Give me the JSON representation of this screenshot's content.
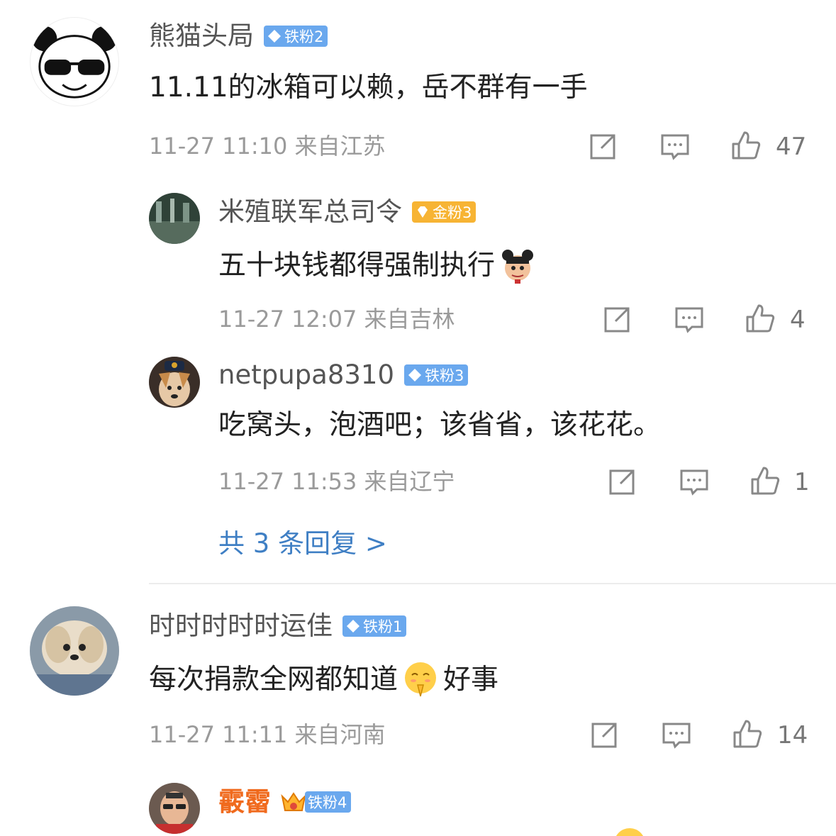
{
  "comments": [
    {
      "user": "熊猫头局",
      "badge": "铁粉2",
      "text": "11.11的冰箱可以赖，岳不群有一手",
      "meta": "11-27 11:10  来自江苏",
      "likes": "47",
      "replies": [
        {
          "user": "米殖联军总司令",
          "badge": "金粉3",
          "text": "五十块钱都得强制执行",
          "meta": "11-27 12:07  来自吉林",
          "likes": "4"
        },
        {
          "user": "netpupa8310",
          "badge": "铁粉3",
          "text": "吃窝头，泡酒吧；该省省，该花花。",
          "meta": "11-27 11:53  来自辽宁",
          "likes": "1"
        }
      ],
      "more_replies": "共 3 条回复 >"
    },
    {
      "user": "时时时时时运佳",
      "badge": "铁粉1",
      "text_before": "每次捐款全网都知道",
      "text_after": "好事",
      "meta": "11-27 11:11  来自河南",
      "likes": "14",
      "replies": [
        {
          "user": "霰霤",
          "badge": "铁粉4"
        }
      ]
    }
  ],
  "icons": [
    "repost-icon",
    "comment-icon",
    "like-icon",
    "diamond-icon",
    "crown-icon"
  ],
  "colors": {
    "badge_blue": "#6aa8ee",
    "badge_gold": "#f7b434",
    "link_blue": "#3f7fc4",
    "vip_orange": "#f06a1d"
  }
}
